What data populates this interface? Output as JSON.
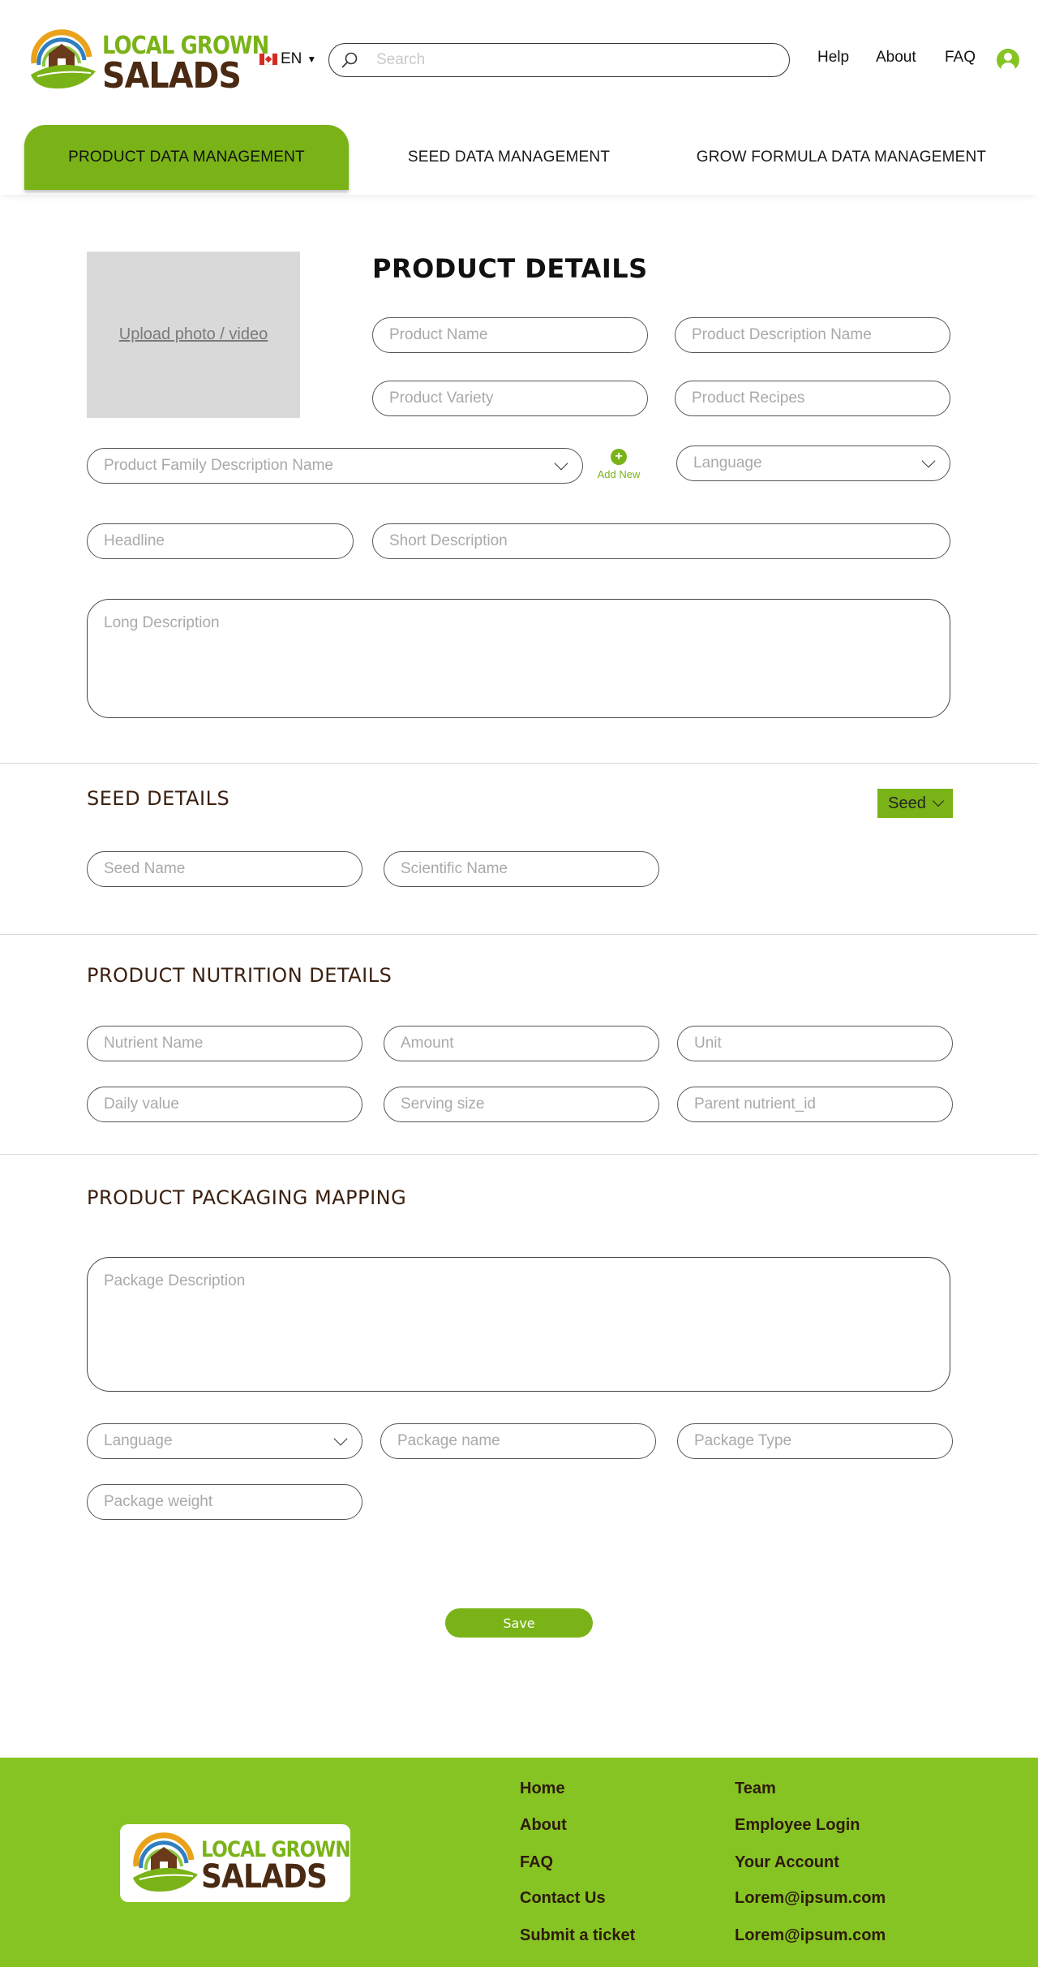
{
  "header": {
    "logo": {
      "line1": "LOCAL GROWN",
      "line2": "SALADS"
    },
    "language": "EN",
    "search_placeholder": "Search",
    "nav": [
      "Help",
      "About",
      "FAQ"
    ]
  },
  "tabs": [
    {
      "label": "PRODUCT DATA MANAGEMENT",
      "active": true
    },
    {
      "label": "SEED DATA MANAGEMENT",
      "active": false
    },
    {
      "label": "GROW FORMULA DATA MANAGEMENT",
      "active": false
    }
  ],
  "product": {
    "upload_label": "Upload photo / video",
    "title": "PRODUCT DETAILS",
    "product_name": "Product Name",
    "product_description_name": "Product Description Name",
    "product_variety": "Product Variety",
    "product_recipes": "Product Recipes",
    "product_family": "Product Family Description Name",
    "add_new": "Add New",
    "language": "Language",
    "headline": "Headline",
    "short_description": "Short Description",
    "long_description": "Long Description"
  },
  "seed": {
    "title": "SEED DETAILS",
    "dropdown": "Seed",
    "seed_name": "Seed Name",
    "scientific_name": "Scientific Name"
  },
  "nutrition": {
    "title": "PRODUCT NUTRITION DETAILS",
    "nutrient_name": "Nutrient Name",
    "amount": "Amount",
    "unit": "Unit",
    "daily_value": "Daily value",
    "serving_size": "Serving size",
    "parent_nutrient_id": "Parent nutrient_id"
  },
  "packaging": {
    "title": "PRODUCT PACKAGING MAPPING",
    "package_description": "Package Description",
    "language": "Language",
    "package_name": "Package name",
    "package_type": "Package Type",
    "package_weight": "Package weight"
  },
  "save_label": "Save",
  "footer": {
    "col1": [
      "Home",
      "About",
      "FAQ",
      "Contact Us",
      "Submit a ticket"
    ],
    "col2": [
      "Team",
      "Employee Login",
      "Your Account",
      "Lorem@ipsum.com",
      "Lorem@ipsum.com"
    ]
  },
  "colors": {
    "brand_green": "#7ab317",
    "footer_green": "#86c423",
    "brown": "#4a2a12"
  }
}
